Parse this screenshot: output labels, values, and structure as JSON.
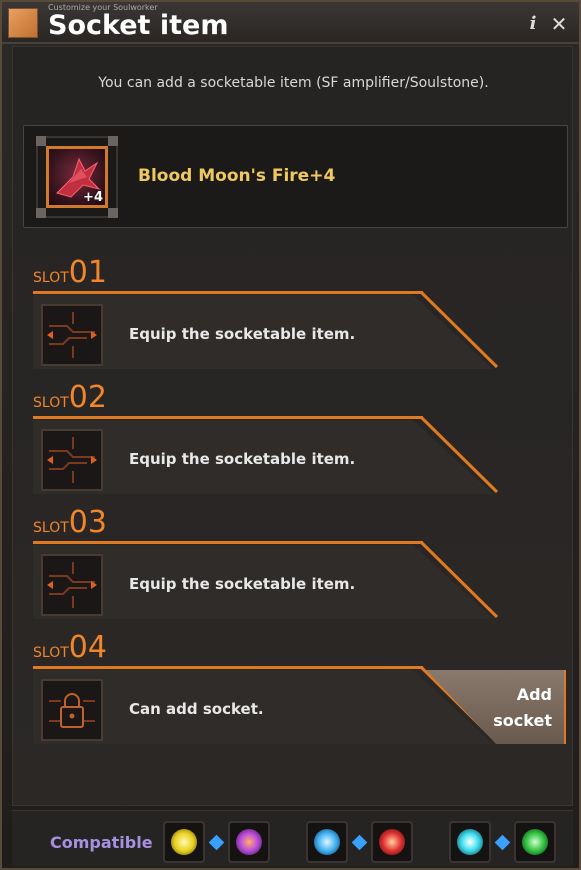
{
  "window": {
    "subtitle": "Customize your Soulworker",
    "title": "Socket item"
  },
  "notice": "You can add a socketable item (SF amplifier/Soulstone).",
  "item": {
    "name": "Blood Moon's Fire+4",
    "enhance": "+4"
  },
  "slots": [
    {
      "word": "SLOT",
      "num": "01",
      "text": "Equip the socketable item.",
      "icon": "circuit-icon"
    },
    {
      "word": "SLOT",
      "num": "02",
      "text": "Equip the socketable item.",
      "icon": "circuit-icon"
    },
    {
      "word": "SLOT",
      "num": "03",
      "text": "Equip the socketable item.",
      "icon": "circuit-icon"
    },
    {
      "word": "SLOT",
      "num": "04",
      "text": "Can add socket.",
      "icon": "lock-icon"
    }
  ],
  "add_socket_label": "Add socket",
  "footer": {
    "label": "Compatible",
    "gems": [
      "yellow-gem-icon",
      "purple-gem-icon",
      "blue-gem-icon",
      "red-gem-icon",
      "cyan-gem-icon",
      "green-gem-icon"
    ]
  },
  "colors": {
    "accent": "#e07a20",
    "item_name": "#f0c860",
    "compatible": "#a890e0",
    "connector": "#3aa0ff"
  }
}
